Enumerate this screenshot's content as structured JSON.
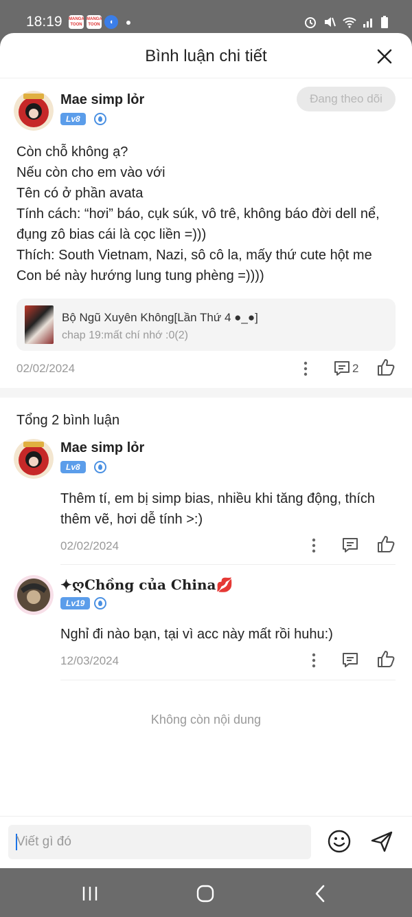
{
  "status_bar": {
    "time": "18:19",
    "app_icons": [
      "MANGA TOON",
      "MANGA TOON",
      "shield"
    ]
  },
  "header": {
    "title": "Bình luận chi tiết",
    "close_icon": "close-icon"
  },
  "post": {
    "author": "Mae simp lỏr",
    "level": "Lv8",
    "follow_label": "Đang theo dõi",
    "lines": [
      "Còn chỗ không ạ?",
      "Nếu còn cho em vào với",
      "Tên có ở phần avata",
      "Tính cách: “hơi” báo, cụk súk, vô trê, không báo đời dell nể,",
      "đụng zô bias cái là cọc liền =)))",
      "Thích: South Vietnam, Nazi, sô cô la, mấy thứ cute hột me",
      "Con bé này hướng lung tung phèng =))))"
    ],
    "ref": {
      "title": "Bộ Ngũ Xuyên Không[Lần Thứ 4 ●_●]",
      "subtitle": "chap 19:mất chí nhớ :0(2)"
    },
    "date": "02/02/2024",
    "comment_count": "2"
  },
  "replies_total": "Tổng 2 bình luận",
  "replies": [
    {
      "author": "Mae simp lỏr",
      "level": "Lv8",
      "text_lines": [
        "Thêm tí, em bị simp bias, nhiều khi tăng động, thích",
        "thêm vẽ, hơi dễ tính >:)"
      ],
      "date": "02/02/2024"
    },
    {
      "author": "✦ღChồng của China💋",
      "level": "Lv19",
      "text_lines": [
        "Nghỉ đi nào bạn, tại vì acc này mất rồi huhu:)"
      ],
      "date": "12/03/2024"
    }
  ],
  "no_more": "Không còn nội dung",
  "composer": {
    "placeholder": "Viết gì đó"
  },
  "colors": {
    "accent": "#4a90e2",
    "muted": "#999999",
    "level_badge": "#5b9dea"
  }
}
